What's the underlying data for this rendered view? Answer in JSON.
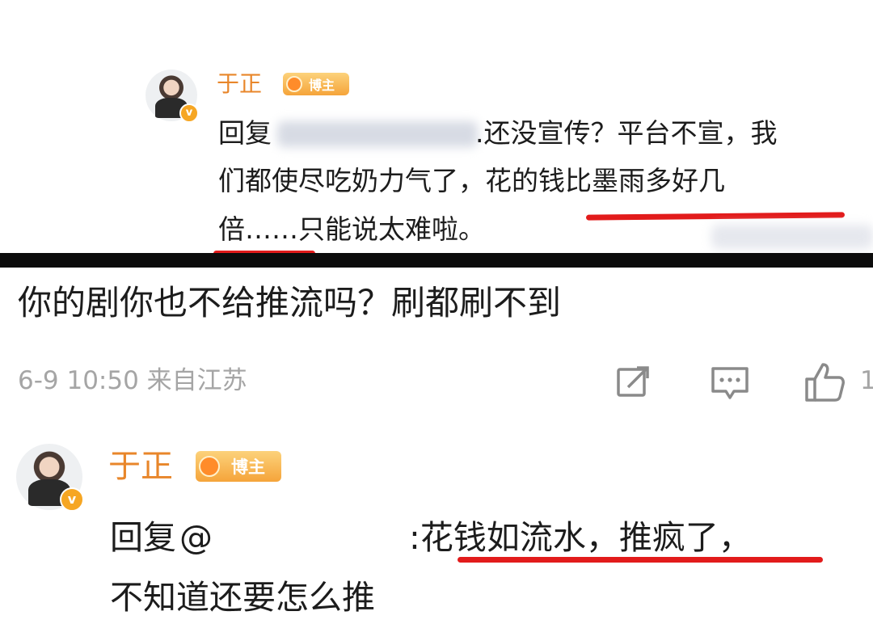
{
  "top_comment": {
    "author": "于正",
    "badge": "博主",
    "verified_mark": "v",
    "reply_prefix": "回复",
    "line1_rest": ".还没宣传？平台不宣，我",
    "line2": "们都使尽吃奶力气了，花的钱比墨雨多好几",
    "line3": "倍……只能说太难啦。"
  },
  "main_comment": {
    "text": "你的剧你也不给推流吗？刷都刷不到",
    "meta": "6-9 10:50 来自江苏",
    "like_partial": "1",
    "icons": [
      "share-icon",
      "comment-icon",
      "like-icon"
    ]
  },
  "reply": {
    "author": "于正",
    "badge": "博主",
    "verified_mark": "v",
    "reply_prefix": "回复",
    "at_sign": "@",
    "line1_rest": ":花钱如流水，推疯了，",
    "line2": "不知道还要怎么推"
  },
  "colors": {
    "name_orange": "#e8862a",
    "underline_red": "#e21b1b",
    "meta_gray": "#a5a5a5",
    "divider": "#0c0c0c"
  }
}
